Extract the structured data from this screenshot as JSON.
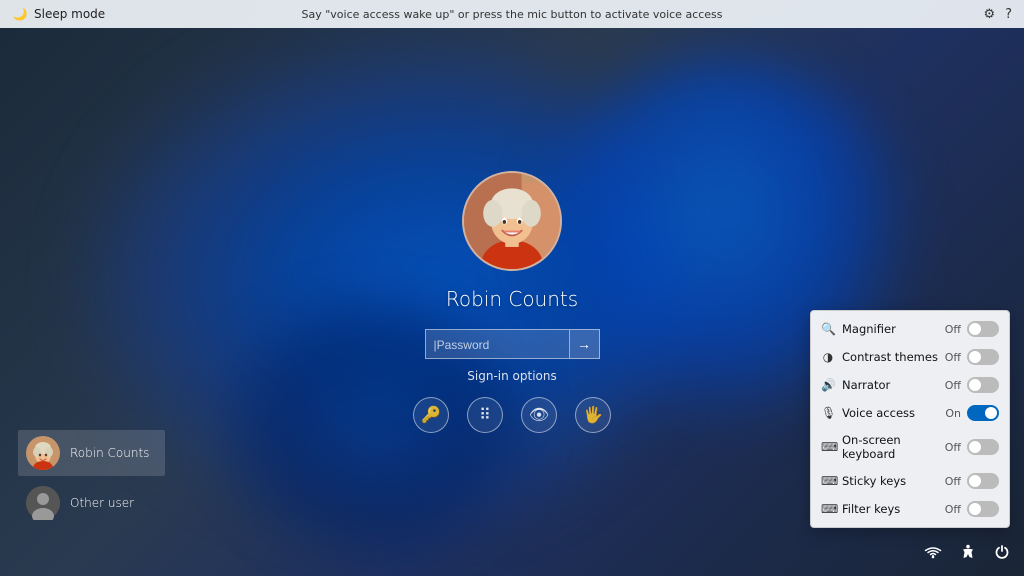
{
  "topbar": {
    "sleep_label": "Sleep mode",
    "voice_hint": "Say \"voice access wake up\" or press the mic button to activate voice access",
    "settings_icon": "⚙",
    "help_icon": "?"
  },
  "login": {
    "username": "Robin Counts",
    "password_placeholder": "|Password",
    "signin_options": "Sign-in options",
    "submit_arrow": "→"
  },
  "users": [
    {
      "name": "Robin Counts",
      "type": "photo"
    },
    {
      "name": "Other user",
      "type": "generic"
    }
  ],
  "bottom_icons": {
    "wifi": "wifi",
    "accessibility": "♿",
    "power": "⏻"
  },
  "accessibility": {
    "items": [
      {
        "label": "Magnifier",
        "icon": "🔍",
        "state": "Off",
        "on": false
      },
      {
        "label": "Contrast themes",
        "icon": "◑",
        "state": "Off",
        "on": false
      },
      {
        "label": "Narrator",
        "icon": "🔊",
        "state": "Off",
        "on": false
      },
      {
        "label": "Voice access",
        "icon": "🎙",
        "state": "On",
        "on": true
      },
      {
        "label": "On-screen keyboard",
        "icon": "⌨",
        "state": "Off",
        "on": false
      },
      {
        "label": "Sticky keys",
        "icon": "⌨",
        "state": "Off",
        "on": false
      },
      {
        "label": "Filter keys",
        "icon": "⌨",
        "state": "Off",
        "on": false
      }
    ]
  }
}
